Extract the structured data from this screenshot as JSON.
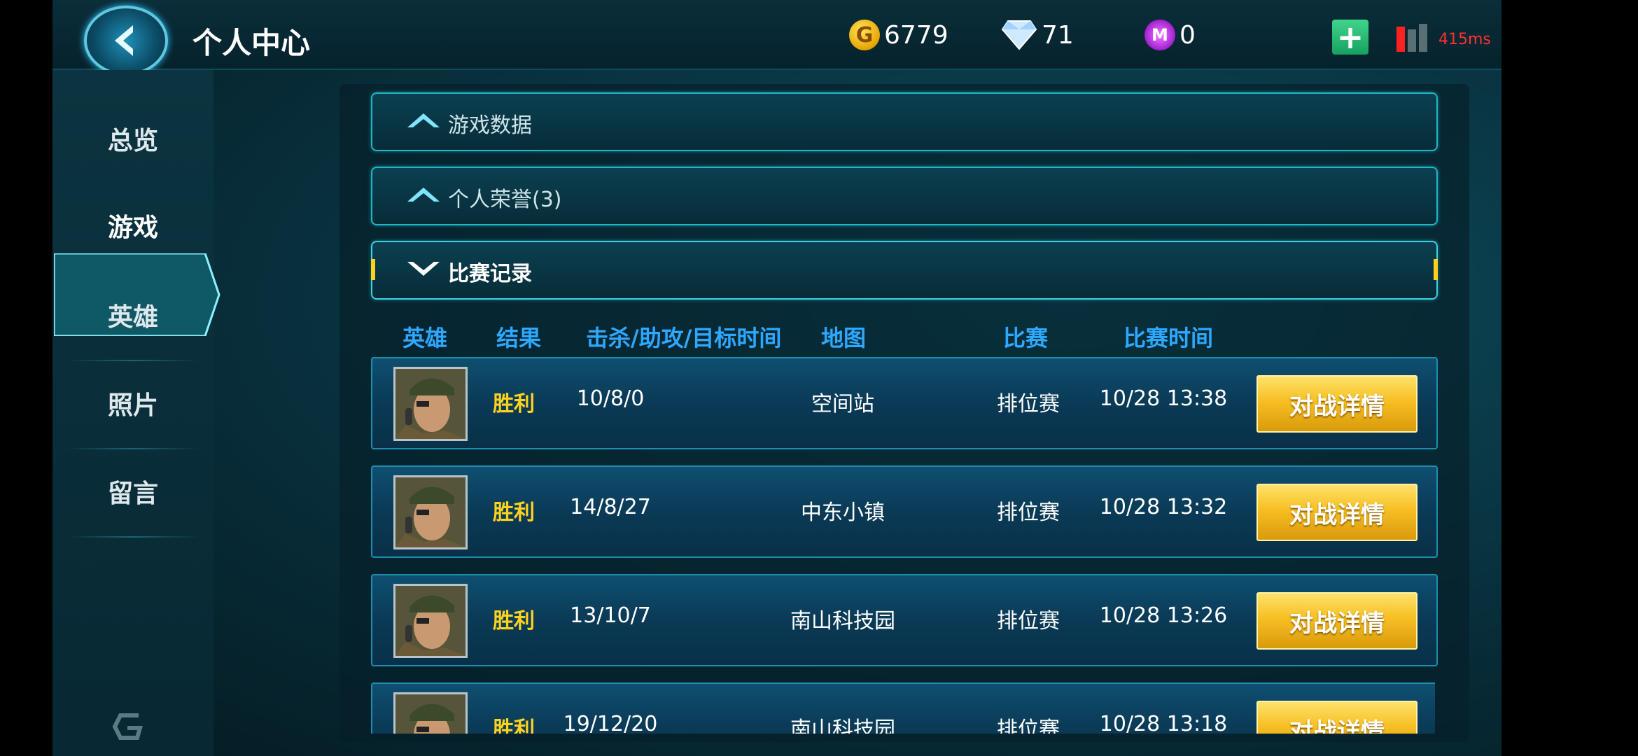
{
  "header": {
    "title": "个人中心",
    "gold": "6779",
    "gold_icon_letter": "G",
    "diamond": "71",
    "gem": "0",
    "gem_icon_letter": "M",
    "ping": "415ms",
    "add_label": "+"
  },
  "sidebar": {
    "items": [
      {
        "label": "总览"
      },
      {
        "label": "游戏"
      },
      {
        "label": "英雄"
      },
      {
        "label": "照片"
      },
      {
        "label": "留言"
      }
    ]
  },
  "sections": {
    "game_data": "游戏数据",
    "honor": "个人荣誉(3)",
    "match_record": "比赛记录"
  },
  "columns": {
    "hero": "英雄",
    "result": "结果",
    "kda": "击杀/助攻/目标时间",
    "map": "地图",
    "match": "比赛",
    "time": "比赛时间"
  },
  "matches": [
    {
      "result": "胜利",
      "kda": "10/8/0",
      "map": "空间站",
      "mode": "排位赛",
      "time": "10/28 13:38",
      "button": "对战详情"
    },
    {
      "result": "胜利",
      "kda": "14/8/27",
      "map": "中东小镇",
      "mode": "排位赛",
      "time": "10/28 13:32",
      "button": "对战详情"
    },
    {
      "result": "胜利",
      "kda": "13/10/7",
      "map": "南山科技园",
      "mode": "排位赛",
      "time": "10/28 13:26",
      "button": "对战详情"
    },
    {
      "result": "胜利",
      "kda": "19/12/20",
      "map": "南山科技园",
      "mode": "排位赛",
      "time": "10/28 13:18",
      "button": "对战详情"
    }
  ],
  "colors": {
    "accent": "#2ea8ff",
    "result": "#ffd21e",
    "button": "#f6bf23",
    "border": "#1fb7c8"
  }
}
